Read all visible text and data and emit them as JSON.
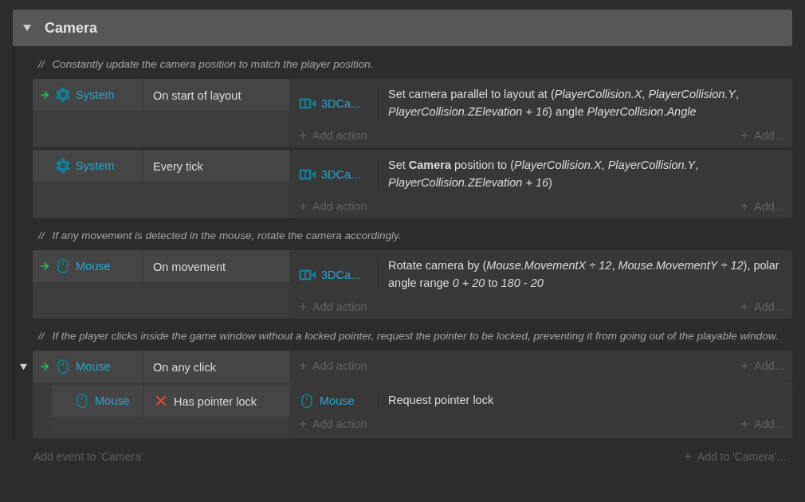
{
  "group": {
    "title": "Camera",
    "expanded": true
  },
  "items": [
    {
      "kind": "comment",
      "prefix": "//",
      "text": "Constantly update the camera position to match the player position."
    },
    {
      "kind": "event",
      "trigger": true,
      "conditions": [
        {
          "kind": "system",
          "object": "System",
          "text": "On start of layout",
          "inverted": false
        }
      ],
      "actions": [
        {
          "kind": "camera3d",
          "object": "3DCa...",
          "text": "Set camera parallel to layout at (*PlayerCollision.X*, *PlayerCollision.Y*, *PlayerCollision.ZElevation* *+* *16*) angle *PlayerCollision.Angle*"
        }
      ],
      "add_action": "Add action",
      "add_more": "Add..."
    },
    {
      "kind": "event",
      "trigger": false,
      "conditions": [
        {
          "kind": "system",
          "object": "System",
          "text": "Every tick",
          "inverted": false
        }
      ],
      "actions": [
        {
          "kind": "camera3d",
          "object": "3DCa...",
          "text": "Set **Camera** position to (*PlayerCollision.X*, *PlayerCollision.Y*, *PlayerCollision.ZElevation* *+* *16*)"
        }
      ],
      "add_action": "Add action",
      "add_more": "Add..."
    },
    {
      "kind": "comment",
      "prefix": "//",
      "text": "If any movement is detected in the mouse, rotate the camera accordingly."
    },
    {
      "kind": "event",
      "trigger": true,
      "conditions": [
        {
          "kind": "mouse",
          "object": "Mouse",
          "text": "On movement",
          "inverted": false
        }
      ],
      "actions": [
        {
          "kind": "camera3d",
          "object": "3DCa...",
          "text": "Rotate camera by (*Mouse.MovementX* *÷* *12*, *Mouse.MovementY* *÷* *12*), polar angle range *0* *+* *20* to *180* *-* *20*"
        }
      ],
      "add_action": "Add action",
      "add_more": "Add..."
    },
    {
      "kind": "comment",
      "prefix": "//",
      "text": "If the player clicks inside the game window without a locked pointer, request the pointer to be locked, preventing it from going out of the playable window."
    },
    {
      "kind": "event",
      "trigger": true,
      "expanded": true,
      "conditions": [
        {
          "kind": "mouse",
          "object": "Mouse",
          "text": "On any click",
          "inverted": false
        }
      ],
      "add_action": "Add action",
      "add_more": "Add...",
      "children": [
        {
          "kind": "event",
          "trigger": false,
          "conditions": [
            {
              "kind": "mouse",
              "object": "Mouse",
              "text": "Has pointer lock",
              "inverted": true
            }
          ],
          "actions": [
            {
              "kind": "mouse",
              "object": "Mouse",
              "text": "Request pointer lock"
            }
          ],
          "add_action": "Add action",
          "add_more": "Add..."
        }
      ]
    }
  ],
  "footer": {
    "add_event": "Add event to 'Camera'",
    "add_to": "Add to 'Camera'..."
  }
}
